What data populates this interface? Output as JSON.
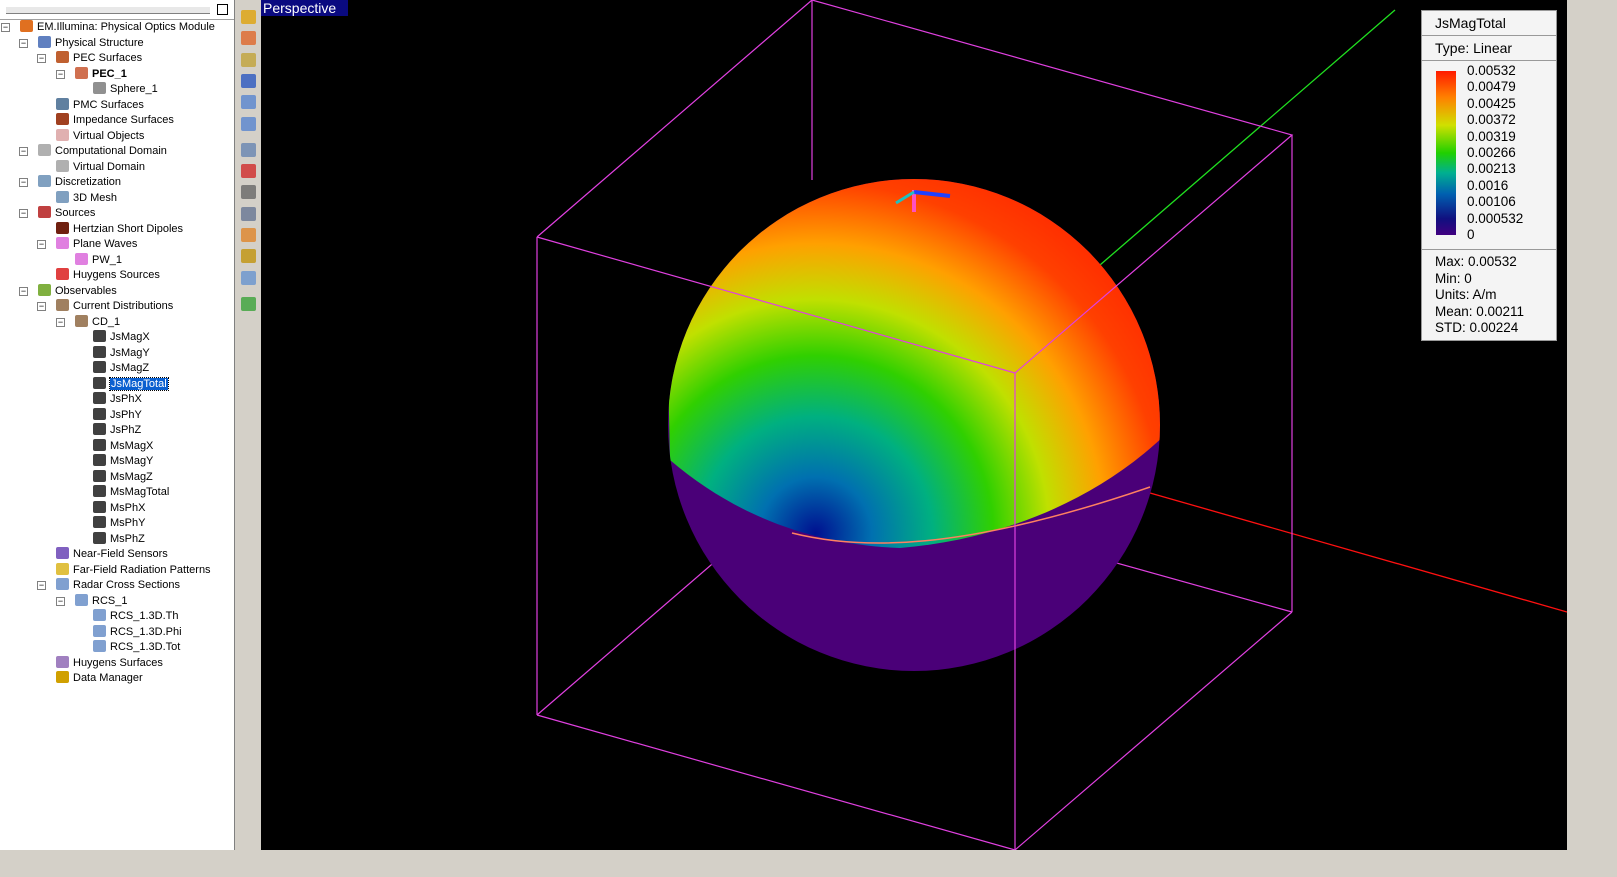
{
  "viewport": {
    "mode": "Perspective"
  },
  "tree": [
    {
      "l": 0,
      "t": "EM.Illumina: Physical Optics Module",
      "ex": "-",
      "c": "#e07020"
    },
    {
      "l": 1,
      "t": "Physical Structure",
      "ex": "-",
      "c": "#6080c0"
    },
    {
      "l": 2,
      "t": "PEC Surfaces",
      "ex": "-",
      "c": "#c06030"
    },
    {
      "l": 3,
      "t": "PEC_1",
      "ex": "-",
      "c": "#d07050",
      "b": true
    },
    {
      "l": 4,
      "t": "Sphere_1",
      "c": "#909090"
    },
    {
      "l": 2,
      "t": "PMC Surfaces",
      "c": "#6080a0"
    },
    {
      "l": 2,
      "t": "Impedance Surfaces",
      "c": "#a04020"
    },
    {
      "l": 2,
      "t": "Virtual Objects",
      "c": "#e0b0b0"
    },
    {
      "l": 1,
      "t": "Computational Domain",
      "ex": "-",
      "c": "#b0b0b0"
    },
    {
      "l": 2,
      "t": "Virtual Domain",
      "c": "#b0b0b0"
    },
    {
      "l": 1,
      "t": "Discretization",
      "ex": "-",
      "c": "#80a0c0"
    },
    {
      "l": 2,
      "t": "3D Mesh",
      "c": "#80a0c0"
    },
    {
      "l": 1,
      "t": "Sources",
      "ex": "-",
      "c": "#c04040"
    },
    {
      "l": 2,
      "t": "Hertzian Short Dipoles",
      "c": "#702010"
    },
    {
      "l": 2,
      "t": "Plane Waves",
      "ex": "-",
      "c": "#e080e0"
    },
    {
      "l": 3,
      "t": "PW_1",
      "c": "#e080e0"
    },
    {
      "l": 2,
      "t": "Huygens Sources",
      "c": "#e04040"
    },
    {
      "l": 1,
      "t": "Observables",
      "ex": "-",
      "c": "#80b040"
    },
    {
      "l": 2,
      "t": "Current Distributions",
      "ex": "-",
      "c": "#a08060"
    },
    {
      "l": 3,
      "t": "CD_1",
      "ex": "-",
      "c": "#a08060"
    },
    {
      "l": 4,
      "t": "JsMagX",
      "c": "#404040"
    },
    {
      "l": 4,
      "t": "JsMagY",
      "c": "#404040"
    },
    {
      "l": 4,
      "t": "JsMagZ",
      "c": "#404040"
    },
    {
      "l": 4,
      "t": "JsMagTotal",
      "c": "#404040",
      "sel": true
    },
    {
      "l": 4,
      "t": "JsPhX",
      "c": "#404040"
    },
    {
      "l": 4,
      "t": "JsPhY",
      "c": "#404040"
    },
    {
      "l": 4,
      "t": "JsPhZ",
      "c": "#404040"
    },
    {
      "l": 4,
      "t": "MsMagX",
      "c": "#404040"
    },
    {
      "l": 4,
      "t": "MsMagY",
      "c": "#404040"
    },
    {
      "l": 4,
      "t": "MsMagZ",
      "c": "#404040"
    },
    {
      "l": 4,
      "t": "MsMagTotal",
      "c": "#404040"
    },
    {
      "l": 4,
      "t": "MsPhX",
      "c": "#404040"
    },
    {
      "l": 4,
      "t": "MsPhY",
      "c": "#404040"
    },
    {
      "l": 4,
      "t": "MsPhZ",
      "c": "#404040"
    },
    {
      "l": 2,
      "t": "Near-Field Sensors",
      "c": "#8060c0"
    },
    {
      "l": 2,
      "t": "Far-Field Radiation Patterns",
      "c": "#e0c040"
    },
    {
      "l": 2,
      "t": "Radar Cross Sections",
      "ex": "-",
      "c": "#80a0d0"
    },
    {
      "l": 3,
      "t": "RCS_1",
      "ex": "-",
      "c": "#80a0d0"
    },
    {
      "l": 4,
      "t": "RCS_1.3D.Th",
      "c": "#80a0d0"
    },
    {
      "l": 4,
      "t": "RCS_1.3D.Phi",
      "c": "#80a0d0"
    },
    {
      "l": 4,
      "t": "RCS_1.3D.Tot",
      "c": "#80a0d0"
    },
    {
      "l": 2,
      "t": "Huygens Surfaces",
      "c": "#a080c0"
    },
    {
      "l": 2,
      "t": "Data Manager",
      "c": "#d0a000"
    }
  ],
  "legend": {
    "title": "JsMagTotal",
    "type": "Type: Linear",
    "levels": [
      "0.00532",
      "0.00479",
      "0.00425",
      "0.00372",
      "0.00319",
      "0.00266",
      "0.00213",
      "0.0016",
      "0.00106",
      "0.000532",
      "0"
    ],
    "max": "Max: 0.00532",
    "min": "Min: 0",
    "units": "Units: A/m",
    "mean": "Mean: 0.00211",
    "std": "STD: 0.00224"
  },
  "toolbar": [
    "ruler",
    "probe",
    "calc",
    "box",
    "grid",
    "grid2",
    "fx",
    "excel",
    "x2",
    "report",
    "check",
    "plot",
    "save",
    "star"
  ]
}
